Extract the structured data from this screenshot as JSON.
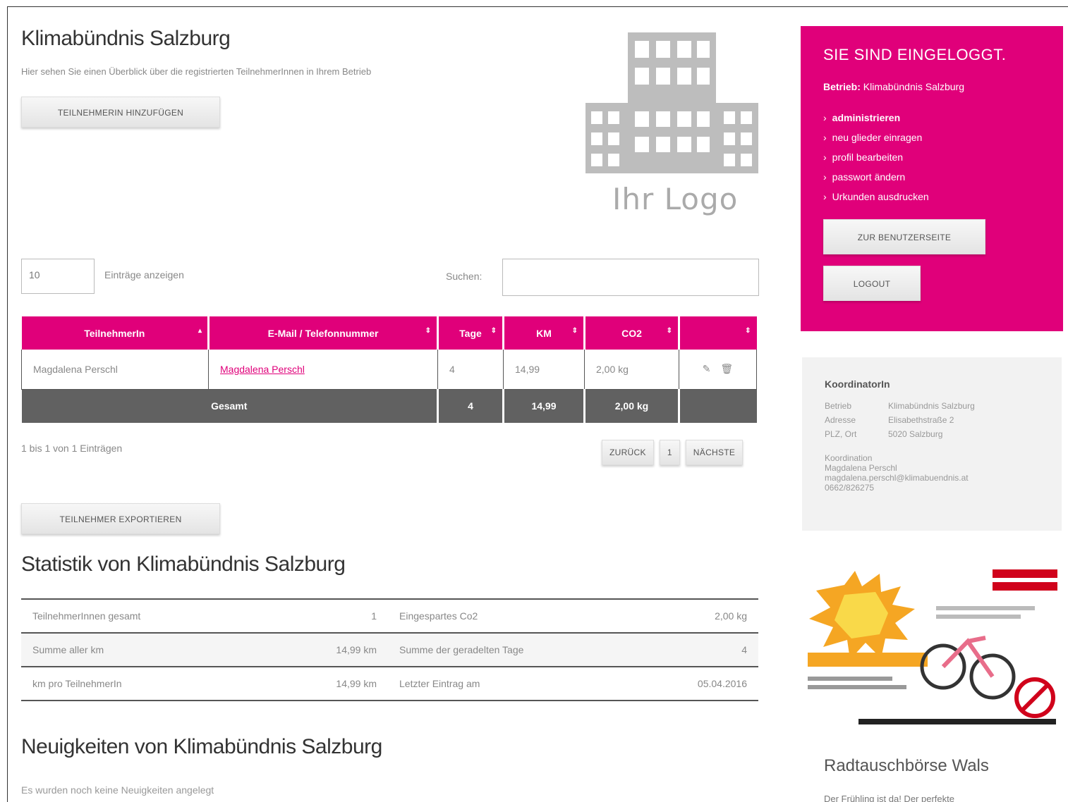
{
  "main": {
    "title": "Klimabündnis Salzburg",
    "subtitle": "Hier sehen Sie einen Überblick über die registrierten TeilnehmerInnen in Ihrem Betrieb",
    "add_button": "TEILNEHMERIN HINZUFÜGEN",
    "logo_text": "Ihr Logo",
    "length_value": "10",
    "length_label": "Einträge anzeigen",
    "search_label": "Suchen:",
    "search_value": ""
  },
  "table": {
    "headers": [
      "TeilnehmerIn",
      "E-Mail / Telefonnummer",
      "Tage",
      "KM",
      "CO2",
      ""
    ],
    "rows": [
      {
        "name": "Magdalena Perschl",
        "contact": "Magdalena Perschl",
        "days": "4",
        "km": "14,99",
        "co2": "2,00 kg"
      }
    ],
    "total": {
      "label": "Gesamt",
      "days": "4",
      "km": "14,99",
      "co2": "2,00 kg"
    },
    "info": "1 bis 1 von 1 Einträgen",
    "pager": {
      "prev": "ZURÜCK",
      "page": "1",
      "next": "NÄCHSTE"
    }
  },
  "export_button": "TEILNEHMER EXPORTIEREN",
  "stats": {
    "title": "Statistik von Klimabündnis Salzburg",
    "rows": [
      [
        {
          "label": "TeilnehmerInnen gesamt",
          "value": "1"
        },
        {
          "label": "Eingespartes Co2",
          "value": "2,00 kg"
        }
      ],
      [
        {
          "label": "Summe aller km",
          "value": "14,99 km"
        },
        {
          "label": "Summe der geradelten Tage",
          "value": "4"
        }
      ],
      [
        {
          "label": "km pro TeilnehmerIn",
          "value": "14,99 km"
        },
        {
          "label": "Letzter Eintrag am",
          "value": "05.04.2016"
        }
      ]
    ]
  },
  "news": {
    "title": "Neuigkeiten von Klimabündnis Salzburg",
    "empty": "Es wurden noch keine Neuigkeiten angelegt"
  },
  "sidebar": {
    "login_title": "SIE SIND EINGELOGGT.",
    "betrieb_label": "Betrieb:",
    "betrieb_value": "Klimabündnis Salzburg",
    "links": [
      "administrieren",
      "neu glieder einragen",
      "profil bearbeiten",
      "passwort ändern",
      "Urkunden ausdrucken"
    ],
    "home_button": "ZUR BENUTZERSEITE",
    "logout_button": "LOGOUT",
    "koordination": {
      "title": "KoordinatorIn",
      "rows": [
        {
          "k": "Betrieb",
          "v": "Klimabündnis Salzburg"
        },
        {
          "k": "Adresse",
          "v": "Elisabethstraße 2"
        },
        {
          "k": "PLZ, Ort",
          "v": "5020 Salzburg"
        }
      ],
      "contact_label": "Koordination",
      "contact_name": "Magdalena Perschl",
      "contact_email": "magdalena.perschl@klimabuendnis.at",
      "contact_phone": "0662/826275"
    },
    "ad_title": "Radtauschbörse Wals",
    "ad_text": "Der Frühling ist da! Der perfekte"
  }
}
